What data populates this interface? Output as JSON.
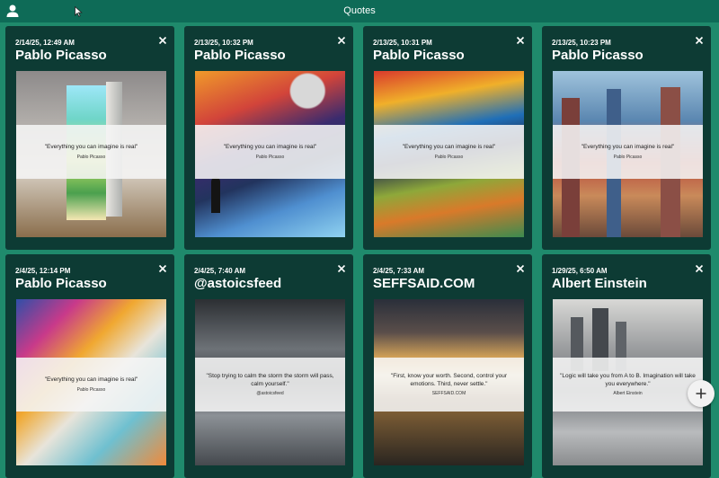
{
  "app": {
    "title": "Quotes"
  },
  "colors": {
    "background": "#1f8a6c",
    "topbar": "#0e6b57",
    "card": "#0d3b34",
    "fab": "#f2f2f2"
  },
  "icons": {
    "user": "user-icon",
    "close": "close-icon",
    "add": "plus-icon",
    "cursor": "cursor-icon"
  },
  "cards": [
    {
      "date": "2/14/25, 12:49 AM",
      "author": "Pablo Picasso",
      "quote": "\"Everything you can imagine is real\"",
      "attribution": "Pablo Picasso"
    },
    {
      "date": "2/13/25, 10:32 PM",
      "author": "Pablo Picasso",
      "quote": "\"Everything you can imagine is real\"",
      "attribution": "Pablo Picasso"
    },
    {
      "date": "2/13/25, 10:31 PM",
      "author": "Pablo Picasso",
      "quote": "\"Everything you can imagine is real\"",
      "attribution": "Pablo Picasso"
    },
    {
      "date": "2/13/25, 10:23 PM",
      "author": "Pablo Picasso",
      "quote": "\"Everything you can imagine is real\"",
      "attribution": "Pablo Picasso"
    },
    {
      "date": "2/4/25, 12:14 PM",
      "author": "Pablo Picasso",
      "quote": "\"Everything you can imagine is real\"",
      "attribution": "Pablo Picasso"
    },
    {
      "date": "2/4/25, 7:40 AM",
      "author": "@astoicsfeed",
      "quote": "\"Stop trying to calm the storm the storm will pass, calm yourself.\"",
      "attribution": "@astoicsfeed"
    },
    {
      "date": "2/4/25, 7:33 AM",
      "author": "SEFFSAID.COM",
      "quote": "\"First, know your worth. Second, control your emotions. Third, never settle.\"",
      "attribution": "SEFFSAID.COM"
    },
    {
      "date": "1/29/25, 6:50 AM",
      "author": "Albert Einstein",
      "quote": "\"Logic will take you from A to B. Imagination will take you everywhere.\"",
      "attribution": "Albert Einstein"
    }
  ]
}
